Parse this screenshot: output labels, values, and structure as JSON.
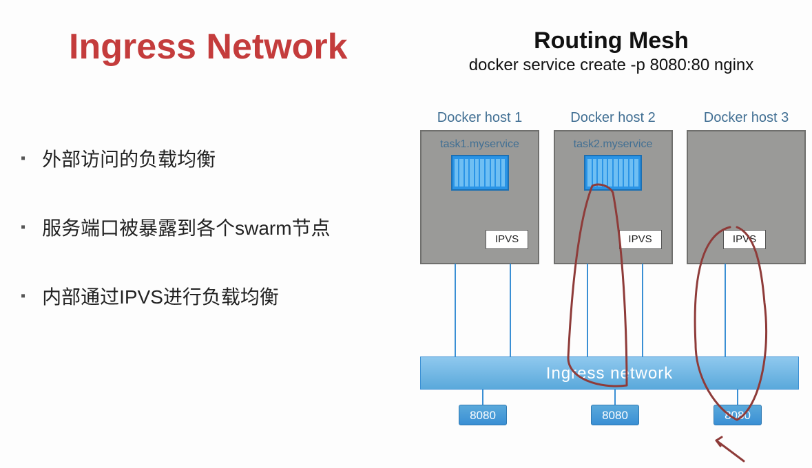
{
  "title": "Ingress Network",
  "bullets": [
    "外部访问的负载均衡",
    "服务端口被暴露到各个swarm节点",
    "内部通过IPVS进行负载均衡"
  ],
  "diagram": {
    "title": "Routing Mesh",
    "subtitle": "docker service create -p 8080:80 nginx",
    "hosts": [
      {
        "label": "Docker host 1",
        "task": "task1.myservice",
        "ipvs": "IPVS",
        "has_container": true
      },
      {
        "label": "Docker host 2",
        "task": "task2.myservice",
        "ipvs": "IPVS",
        "has_container": true
      },
      {
        "label": "Docker host 3",
        "task": "",
        "ipvs": "IPVS",
        "has_container": false
      }
    ],
    "ingress_label": "Ingress network",
    "ports": [
      "8080",
      "8080",
      "8080"
    ]
  }
}
